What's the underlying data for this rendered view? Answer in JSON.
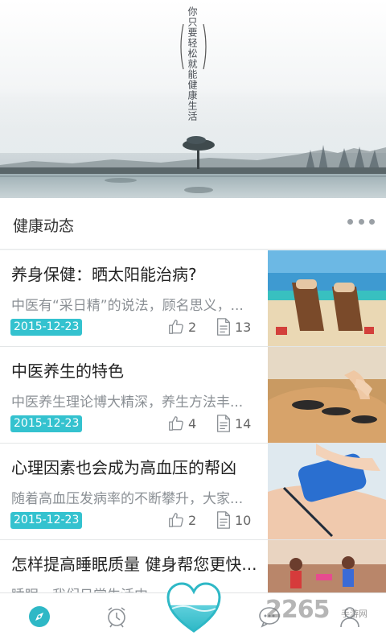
{
  "hero": {
    "slogan": "你只要轻松就能健康生活"
  },
  "section": {
    "title": "健康动态",
    "more_icon": "more-dots-icon"
  },
  "articles": [
    {
      "title": "养身保健：晒太阳能治病?",
      "summary": "中医有“采日精”的说法，顾名思义，...",
      "date": "2015-12-23",
      "likes": "2",
      "comments": "13",
      "thumb": "beach-chairs"
    },
    {
      "title": "中医养生的特色",
      "summary": "中医养生理论博大精深，养生方法丰...",
      "date": "2015-12-23",
      "likes": "4",
      "comments": "14",
      "thumb": "hot-stone-massage"
    },
    {
      "title": "心理因素也会成为高血压的帮凶",
      "summary": "随着高血压发病率的不断攀升，大家...",
      "date": "2015-12-23",
      "likes": "2",
      "comments": "10",
      "thumb": "blood-pressure-cuff"
    },
    {
      "title": "怎样提高睡眠质量 健身帮您更快...",
      "summary": "睡眠，我们日常生活中......第",
      "date": "",
      "likes": "",
      "comments": "",
      "thumb": "fitness-class"
    }
  ],
  "bottom_nav": {
    "items": [
      "compass-icon",
      "alarm-clock-icon",
      "heart-icon",
      "chat-icon",
      "profile-icon"
    ]
  },
  "watermark": {
    "text": "2265",
    "sub": "手游网"
  },
  "colors": {
    "accent": "#34c2cf",
    "nav_active": "#2eb8c6"
  }
}
